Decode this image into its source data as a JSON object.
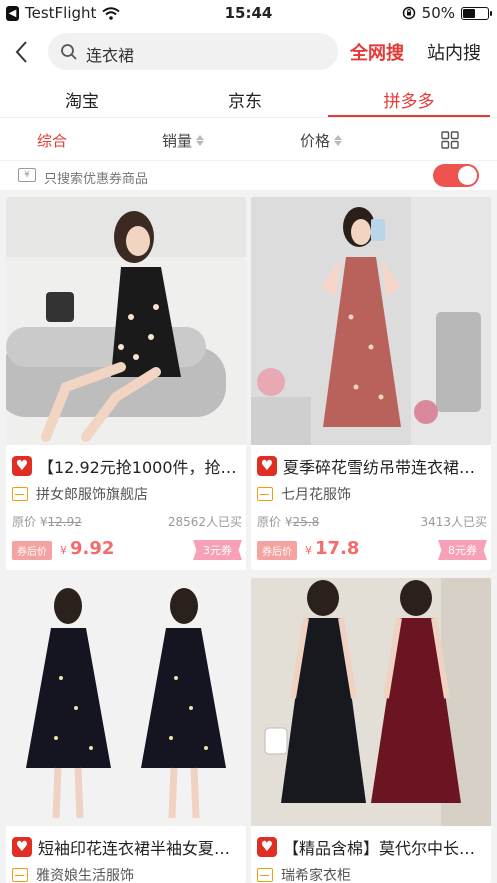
{
  "status_bar": {
    "back_app": "TestFlight",
    "time": "15:44",
    "battery_percent": "50%",
    "battery_level": 0.5
  },
  "search": {
    "query": "连衣裙",
    "scope_active": "全网搜",
    "scope_other": "站内搜"
  },
  "platforms": [
    {
      "label": "淘宝"
    },
    {
      "label": "京东"
    },
    {
      "label": "拼多多"
    }
  ],
  "active_platform": "拼多多",
  "sort": {
    "comprehensive": "综合",
    "sales": "销量",
    "price": "价格"
  },
  "coupon_filter": {
    "label": "只搜索优惠券商品",
    "icon_text": "¥",
    "enabled": true
  },
  "accent_color": "#e53935",
  "products": [
    {
      "title": "【12.92元抢1000件，抢…",
      "shop": "拼女郎服饰旗舰店",
      "orig_label": "原价",
      "orig_price": "12.92",
      "sold": "28562人已买",
      "after_label": "券后价",
      "after_price": "9.92",
      "coupon": "3元券"
    },
    {
      "title": "夏季碎花雪纺吊带连衣裙…",
      "shop": "七月花服饰",
      "orig_label": "原价",
      "orig_price": "25.8",
      "sold": "3413人已买",
      "after_label": "券后价",
      "after_price": "17.8",
      "coupon": "8元券"
    },
    {
      "title": "短袖印花连衣裙半袖女夏…",
      "shop": "雅资娘生活服饰"
    },
    {
      "title": "【精品含棉】莫代尔中长…",
      "shop": "瑞希家衣柜"
    }
  ],
  "currency": "¥"
}
